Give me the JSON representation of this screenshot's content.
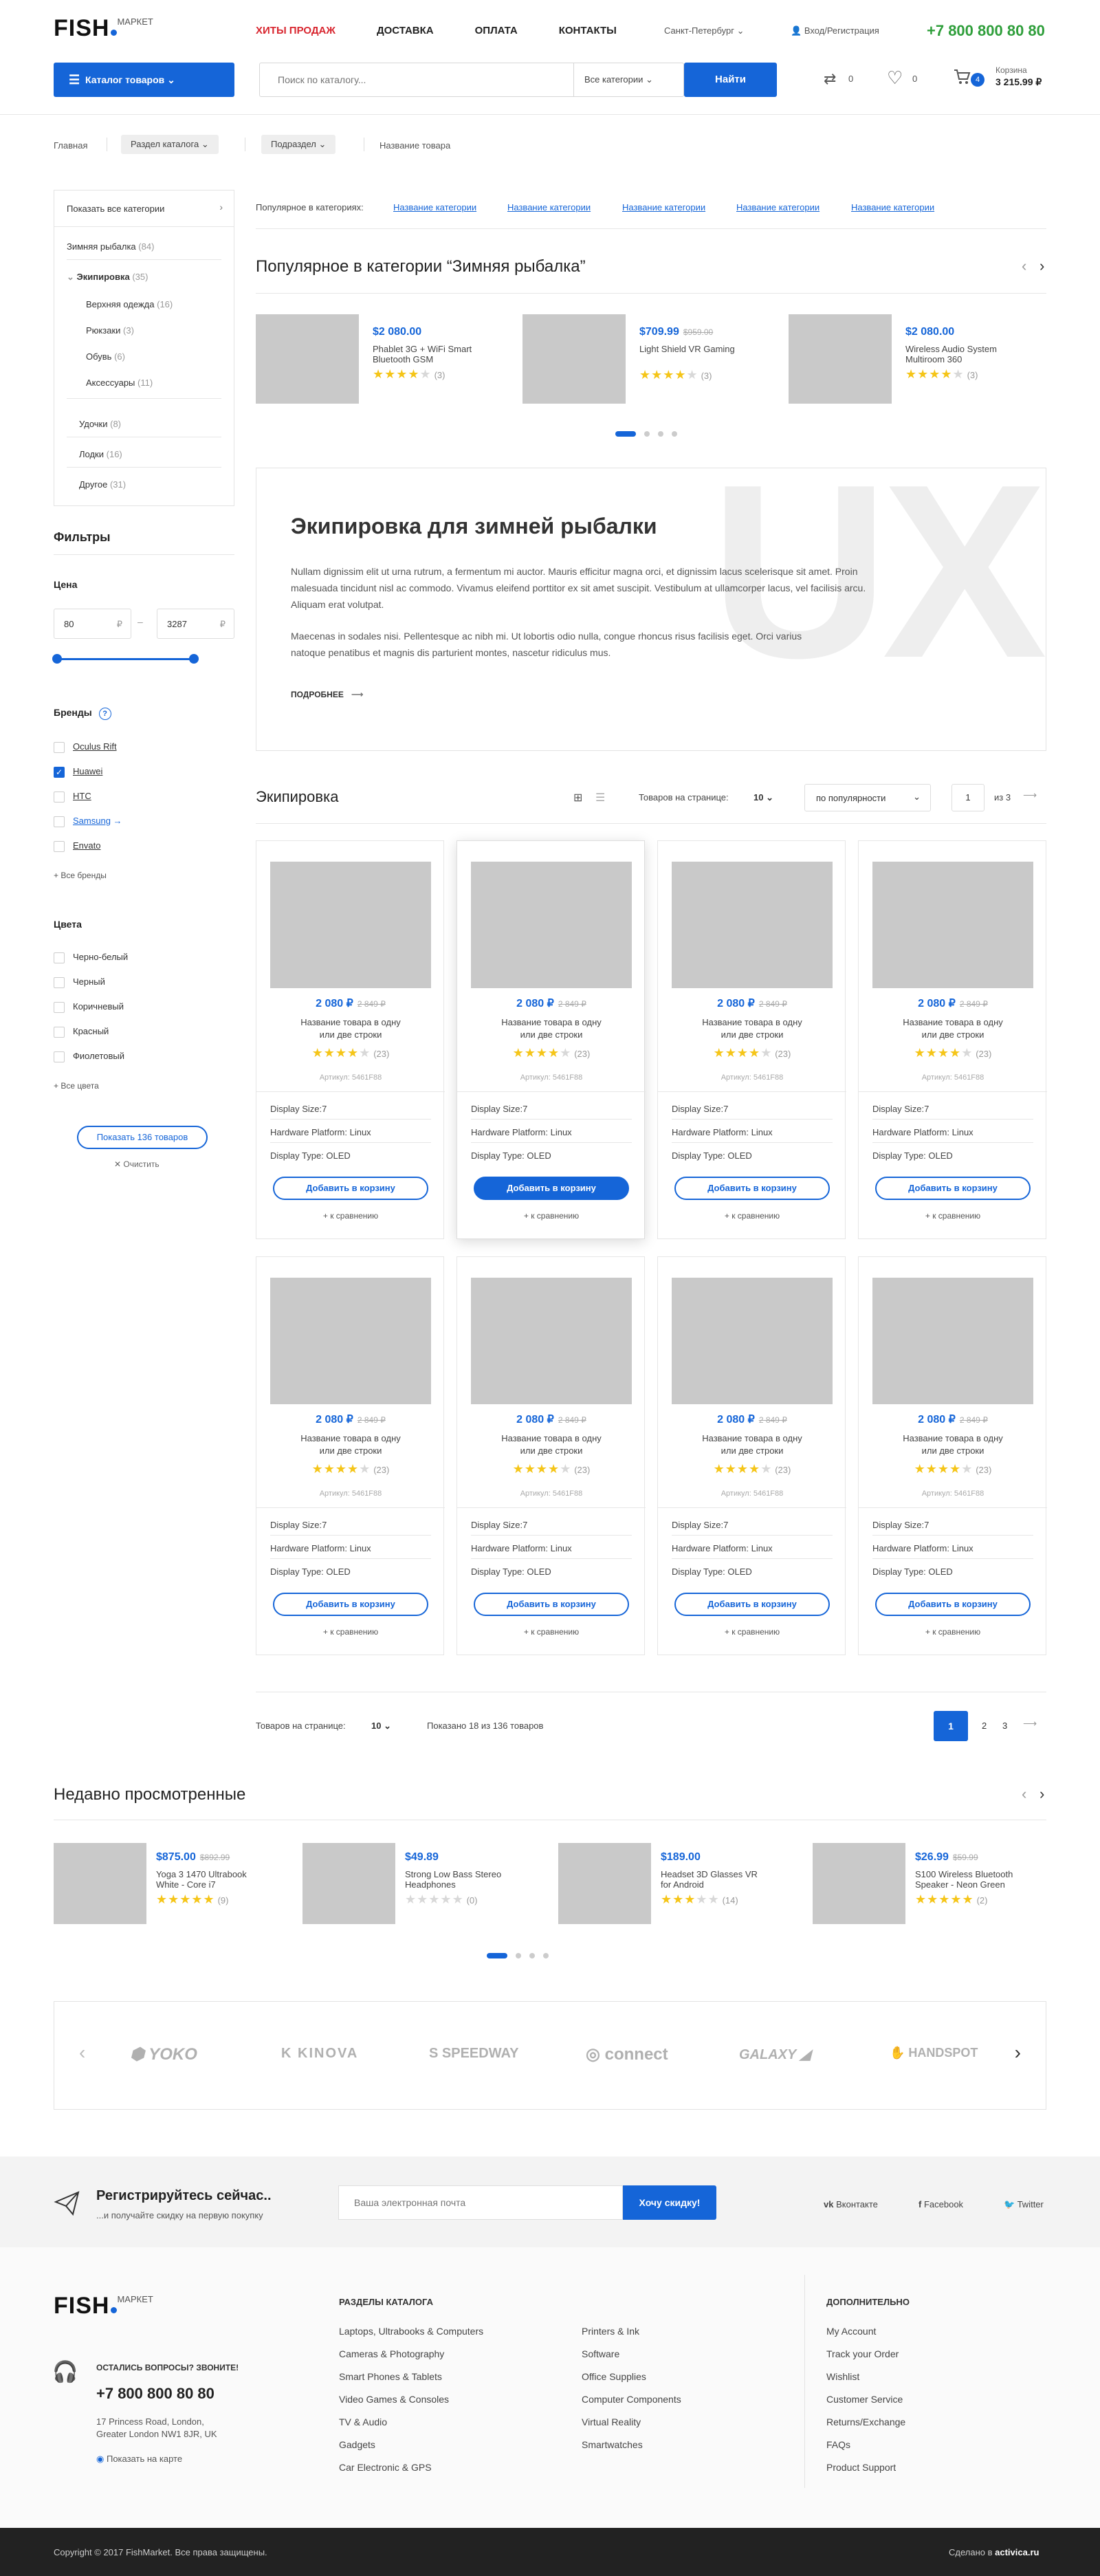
{
  "header": {
    "logo_main": "FISH",
    "logo_sup": "МАРКЕТ",
    "nav": [
      "ХИТЫ ПРОДАЖ",
      "ДОСТАВКА",
      "ОПЛАТА",
      "КОНТАКТЫ"
    ],
    "city": "Санкт-Петербург",
    "auth": "Вход/Регистрация",
    "phone": "+7 800 800 80 80",
    "catalog_btn": "Каталог товаров",
    "search_placeholder": "Поиск по каталогу...",
    "search_category": "Все категории",
    "search_btn": "Найти",
    "compare_count": "0",
    "wishlist_count": "0",
    "cart_count": "4",
    "cart_label": "Корзина",
    "cart_total": "3 215.99 ₽"
  },
  "breadcrumb": [
    "Главная",
    "Раздел каталога",
    "Подраздел",
    "Название товара"
  ],
  "sidebar": {
    "show_all": "Показать все категории",
    "categories": [
      {
        "name": "Зимняя рыбалка",
        "count": "(84)"
      },
      {
        "name": "Экипировка",
        "count": "(35)"
      },
      {
        "name": "Верхняя одежда",
        "count": "(16)"
      },
      {
        "name": "Рюкзаки",
        "count": "(3)"
      },
      {
        "name": "Обувь",
        "count": "(6)"
      },
      {
        "name": "Аксессуары",
        "count": "(11)"
      },
      {
        "name": "Удочки",
        "count": "(8)"
      },
      {
        "name": "Лодки",
        "count": "(16)"
      },
      {
        "name": "Другое",
        "count": "(31)"
      }
    ],
    "filters_title": "Фильтры",
    "price_title": "Цена",
    "price_min": "80",
    "price_max": "3287",
    "currency": "₽",
    "brands_title": "Бренды",
    "brands": [
      "Oculus Rift",
      "Huawei",
      "HTC",
      "Samsung",
      "Envato"
    ],
    "all_brands": "+ Все бренды",
    "colors_title": "Цвета",
    "colors": [
      "Черно-белый",
      "Черный",
      "Коричневый",
      "Красный",
      "Фиолетовый"
    ],
    "all_colors": "+ Все цвета",
    "show_btn": "Показать 136 товаров",
    "clear": "Очистить"
  },
  "popular": {
    "label": "Популярное в категориях:",
    "links": [
      "Название категории",
      "Название категории",
      "Название категории",
      "Название категории",
      "Название категории"
    ],
    "title": "Популярное в категории “Зимняя рыбалка”",
    "items": [
      {
        "price": "$2 080.00",
        "old": "",
        "name1": "Phablet 3G + WiFi Smart",
        "name2": "Bluetooth GSM",
        "count": "(3)"
      },
      {
        "price": "$709.99",
        "old": "$959.00",
        "name1": "Light Shield VR Gaming",
        "name2": "",
        "count": "(3)"
      },
      {
        "price": "$2 080.00",
        "old": "",
        "name1": "Wireless Audio System",
        "name2": "Multiroom 360",
        "count": "(3)"
      }
    ]
  },
  "promo": {
    "title": "Экипировка для зимней рыбалки",
    "p1": "Nullam dignissim elit ut urna rutrum, a fermentum mi auctor. Mauris efficitur magna orci, et dignissim lacus scelerisque sit amet. Proin malesuada tincidunt nisl ac commodo. Vivamus eleifend porttitor ex sit amet suscipit. Vestibulum at ullamcorper lacus, vel facilisis arcu. Aliquam erat volutpat.",
    "p2": "Maecenas in sodales nisi. Pellentesque ac nibh mi. Ut lobortis odio nulla, congue rhoncus risus facilisis eget. Orci varius natoque penatibus et magnis dis parturient montes, nascetur ridiculus mus.",
    "more": "ПОДРОБНЕЕ",
    "watermark": "UX"
  },
  "listing": {
    "title": "Экипировка",
    "per_page_label": "Товаров на странице:",
    "per_page": "10",
    "sort": "по популярности",
    "page": "1",
    "of": "из 3",
    "product": {
      "price": "2 080 ₽",
      "old": "2 849 ₽",
      "name1": "Название товара в одну",
      "name2": "или две строки",
      "count": "(23)",
      "sku": "Артикул: 5461F88",
      "spec1": "Display Size:7",
      "spec2": "Hardware Platform: Linux",
      "spec3": "Display Type: OLED",
      "add": "Добавить в корзину",
      "compare": "+ к сравнению"
    },
    "shown": "Показано 18 из 136 товаров",
    "pages": [
      "1",
      "2",
      "3"
    ]
  },
  "recent": {
    "title": "Недавно просмотренные",
    "items": [
      {
        "price": "$875.00",
        "old": "$892.99",
        "name1": "Yoga 3 1470 Ultrabook",
        "name2": "White - Core i7",
        "count": "(9)",
        "rating": 5
      },
      {
        "price": "$49.89",
        "old": "",
        "name1": "Strong Low Bass Stereo",
        "name2": "Headphones",
        "count": "(0)",
        "rating": 0
      },
      {
        "price": "$189.00",
        "old": "",
        "name1": "Headset 3D Glasses VR",
        "name2": "for Android",
        "count": "(14)",
        "rating": 3
      },
      {
        "price": "$26.99",
        "old": "$59.99",
        "name1": "S100 Wireless Bluetooth",
        "name2": "Speaker - Neon Green",
        "count": "(2)",
        "rating": 5
      }
    ]
  },
  "brands": [
    "YOKO",
    "KINOVA",
    "SPEEDWAY",
    "connect",
    "GALAXY",
    "HANDSPOT"
  ],
  "newsletter": {
    "title": "Регистрируйтесь сейчас..",
    "sub": "...и получайте скидку на первую покупку",
    "placeholder": "Ваша электронная почта",
    "btn": "Хочу скидку!",
    "social": [
      "Вконтакте",
      "Facebook",
      "Twitter"
    ]
  },
  "footer": {
    "questions": "ОСТАЛИСЬ ВОПРОСЫ? ЗВОНИТЕ!",
    "phone": "+7 800 800 80 80",
    "addr1": "17 Princess Road, London,",
    "addr2": "Greater London NW1 8JR, UK",
    "map": "Показать на карте",
    "col1_title": "РАЗДЕЛЫ КАТАЛОГА",
    "col1": [
      "Laptops, Ultrabooks & Computers",
      "Cameras & Photography",
      "Smart Phones & Tablets",
      "Video Games & Consoles",
      "TV & Audio",
      "Gadgets",
      "Car Electronic & GPS"
    ],
    "col2": [
      "Printers & Ink",
      "Software",
      "Office Supplies",
      "Computer Components",
      "Virtual Reality",
      "Smartwatches"
    ],
    "col3_title": "ДОПОЛНИТЕЛЬНО",
    "col3": [
      "My Account",
      "Track your Order",
      "Wishlist",
      "Customer Service",
      "Returns/Exchange",
      "FAQs",
      "Product Support"
    ],
    "copyright": "Copyright © 2017 FishMarket. Все права защищены.",
    "made_by": "Сделано в",
    "studio": "activica.ru"
  }
}
